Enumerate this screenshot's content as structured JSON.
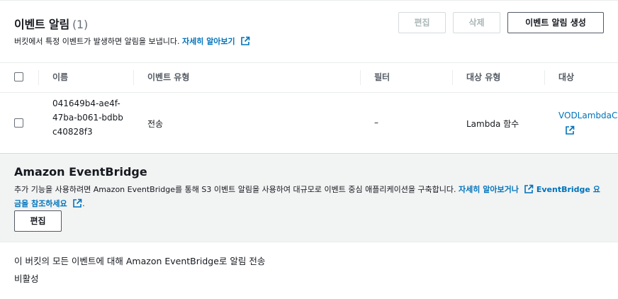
{
  "header": {
    "title": "이벤트 알림",
    "count": "(1)",
    "description": "버킷에서 특정 이벤트가 발생하면 알림을 보냅니다.",
    "learn_more": "자세히 알아보기"
  },
  "buttons": {
    "edit": "편집",
    "delete": "삭제",
    "create": "이벤트 알림 생성"
  },
  "table": {
    "columns": [
      "이름",
      "이벤트 유형",
      "필터",
      "대상 유형",
      "대상"
    ],
    "rows": [
      {
        "name": "041649b4-ae4f-47ba-b061-bdbbc40828f3",
        "event_type": "전송",
        "filter": "–",
        "destination_type": "Lambda 함수",
        "destination": "VODLambdaC"
      }
    ]
  },
  "eventbridge": {
    "title": "Amazon EventBridge",
    "description": "추가 기능을 사용하려면 Amazon EventBridge를 통해 S3 이벤트 알림을 사용하여 대규모로 이벤트 중심 애플리케이션을 구축합니다.",
    "learn_more": "자세히 알아보거나",
    "pricing_link": "EventBridge 요금을 참조하세요",
    "pricing_suffix": ".",
    "edit": "편집",
    "setting_label": "이 버킷의 모든 이벤트에 대해 Amazon EventBridge로 알림 전송",
    "setting_value": "비활성"
  },
  "colors": {
    "link": "#0073bb",
    "section_bg": "#f2f3f3",
    "disabled": "#aab7b8"
  }
}
